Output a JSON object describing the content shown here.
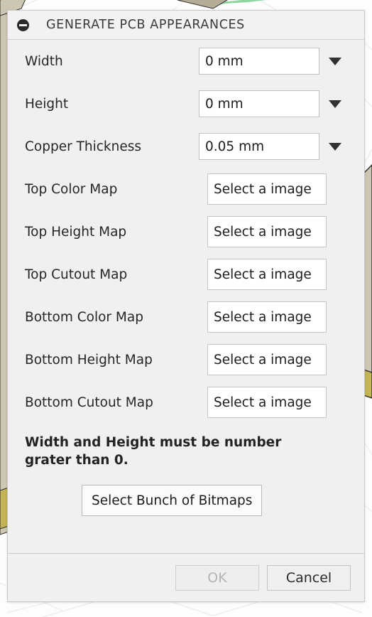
{
  "window": {
    "title": "GENERATE PCB APPEARANCES",
    "collapse_icon": "collapse-circle-icon"
  },
  "form": {
    "combos": [
      {
        "label": "Width",
        "value": "0 mm",
        "arrow_icon": "chevron-down-icon"
      },
      {
        "label": "Height",
        "value": "0 mm",
        "arrow_icon": "chevron-down-icon"
      },
      {
        "label": "Copper Thickness",
        "value": "0.05 mm",
        "arrow_icon": "chevron-down-icon"
      }
    ],
    "image_rows": [
      {
        "label": "Top Color Map",
        "button": "Select a image"
      },
      {
        "label": "Top Height Map",
        "button": "Select a image"
      },
      {
        "label": "Top Cutout Map",
        "button": "Select a image"
      },
      {
        "label": "Bottom Color Map",
        "button": "Select a image"
      },
      {
        "label": "Bottom Height Map",
        "button": "Select a image"
      },
      {
        "label": "Bottom Cutout Map",
        "button": "Select a image"
      }
    ],
    "warning": "Width and Height must be number grater than 0.",
    "bunch_button": "Select Bunch of Bitmaps"
  },
  "footer": {
    "ok_label": "OK",
    "ok_enabled": false,
    "cancel_label": "Cancel",
    "cancel_enabled": true
  },
  "colors": {
    "dialog_bg": "#f0f0f0",
    "title_bg": "#f2f2f2",
    "field_bg": "#ffffff",
    "border": "#c4c4c4",
    "text": "#262626",
    "disabled_text": "#b4b4b4",
    "pcb_face": "#cdc6b2",
    "pcb_edge": "#c3b455",
    "trace_green": "#8fd6a0"
  }
}
